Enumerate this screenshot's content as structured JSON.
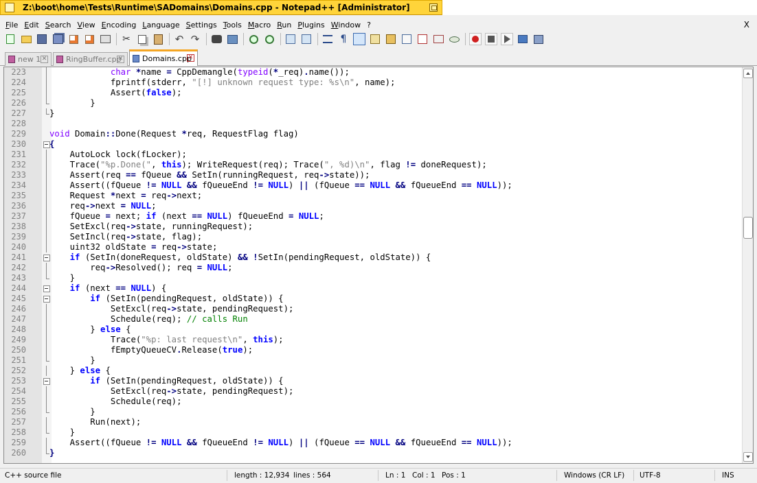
{
  "window": {
    "title": "Z:\\boot\\home\\Tests\\Runtime\\SADomains\\Domains.cpp - Notepad++ [Administrator]"
  },
  "menu": {
    "items": [
      "File",
      "Edit",
      "Search",
      "View",
      "Encoding",
      "Language",
      "Settings",
      "Tools",
      "Macro",
      "Run",
      "Plugins",
      "Window",
      "?"
    ],
    "close_glyph": "X"
  },
  "toolbar": {
    "icons": [
      "new-file-icon",
      "open-file-icon",
      "save-icon",
      "save-all-icon",
      "close-file-icon",
      "close-all-icon",
      "print-icon",
      "cut-icon",
      "copy-icon",
      "paste-icon",
      "undo-icon",
      "redo-icon",
      "find-icon",
      "replace-icon",
      "zoom-in-icon",
      "zoom-out-icon",
      "sync-vertical-icon",
      "sync-horizontal-icon",
      "word-wrap-icon",
      "show-all-characters-icon",
      "indent-guide-icon",
      "user-language-icon",
      "document-map-icon",
      "document-list-icon",
      "function-list-icon",
      "folder-as-workspace-icon",
      "monitoring-icon",
      "record-macro-icon",
      "stop-recording-icon",
      "playback-icon",
      "run-macro-multiple-icon",
      "save-macro-icon"
    ]
  },
  "tabs": [
    {
      "label": "new 1",
      "active": false,
      "modified": true
    },
    {
      "label": "RingBuffer.cpp",
      "active": false,
      "modified": true
    },
    {
      "label": "Domains.cpp",
      "active": true,
      "modified": false
    }
  ],
  "editor": {
    "lines": [
      {
        "n": "223",
        "fold": "bar",
        "code": [
          [
            "",
            "            "
          ],
          [
            "ty",
            "char"
          ],
          [
            "op",
            " *"
          ],
          [
            "",
            "name "
          ],
          [
            "op",
            "="
          ],
          [
            "",
            " CppDemangle("
          ],
          [
            "ty",
            "typeid"
          ],
          [
            "",
            "("
          ],
          [
            "op",
            "*"
          ],
          [
            "",
            "_req)"
          ],
          [
            "op",
            "."
          ],
          [
            "",
            "name());"
          ]
        ]
      },
      {
        "n": "224",
        "fold": "bar",
        "code": [
          [
            "",
            "            fprintf(stderr, "
          ],
          [
            "st",
            "\"[!] unknown request type: %s\\n\""
          ],
          [
            "",
            ", name);"
          ]
        ]
      },
      {
        "n": "225",
        "fold": "bar",
        "code": [
          [
            "",
            "            Assert("
          ],
          [
            "kw",
            "false"
          ],
          [
            "",
            ");"
          ]
        ]
      },
      {
        "n": "226",
        "fold": "end",
        "code": [
          [
            "",
            "        }"
          ]
        ]
      },
      {
        "n": "227",
        "fold": "end",
        "code": [
          [
            "",
            "}"
          ]
        ]
      },
      {
        "n": "228",
        "fold": "",
        "code": [
          [
            "",
            ""
          ]
        ]
      },
      {
        "n": "229",
        "fold": "",
        "code": [
          [
            "ty",
            "void"
          ],
          [
            "",
            " Domain"
          ],
          [
            "op",
            "::"
          ],
          [
            "",
            "Done(Request "
          ],
          [
            "op",
            "*"
          ],
          [
            "",
            "req, RequestFlag flag)"
          ]
        ]
      },
      {
        "n": "230",
        "fold": "box",
        "code": [
          [
            "op",
            "{"
          ]
        ]
      },
      {
        "n": "231",
        "fold": "bar",
        "code": [
          [
            "",
            "    AutoLock lock(fLocker);"
          ]
        ]
      },
      {
        "n": "232",
        "fold": "bar",
        "code": [
          [
            "",
            "    Trace("
          ],
          [
            "st",
            "\"%p.Done(\""
          ],
          [
            "",
            ", "
          ],
          [
            "kw",
            "this"
          ],
          [
            "",
            "); WriteRequest(req); Trace("
          ],
          [
            "st",
            "\", %d)\\n\""
          ],
          [
            "",
            ", flag "
          ],
          [
            "op",
            "!="
          ],
          [
            "",
            " doneRequest);"
          ]
        ]
      },
      {
        "n": "233",
        "fold": "bar",
        "code": [
          [
            "",
            "    Assert(req "
          ],
          [
            "op",
            "=="
          ],
          [
            "",
            " fQueue "
          ],
          [
            "op",
            "&&"
          ],
          [
            "",
            " SetIn(runningRequest, req"
          ],
          [
            "op",
            "->"
          ],
          [
            "",
            "state));"
          ]
        ]
      },
      {
        "n": "234",
        "fold": "bar",
        "code": [
          [
            "",
            "    Assert((fQueue "
          ],
          [
            "op",
            "!="
          ],
          [
            "",
            " "
          ],
          [
            "kw",
            "NULL"
          ],
          [
            "",
            " "
          ],
          [
            "op",
            "&&"
          ],
          [
            "",
            " fQueueEnd "
          ],
          [
            "op",
            "!="
          ],
          [
            "",
            " "
          ],
          [
            "kw",
            "NULL"
          ],
          [
            "",
            ") "
          ],
          [
            "op",
            "||"
          ],
          [
            "",
            " (fQueue "
          ],
          [
            "op",
            "=="
          ],
          [
            "",
            " "
          ],
          [
            "kw",
            "NULL"
          ],
          [
            "",
            " "
          ],
          [
            "op",
            "&&"
          ],
          [
            "",
            " fQueueEnd "
          ],
          [
            "op",
            "=="
          ],
          [
            "",
            " "
          ],
          [
            "kw",
            "NULL"
          ],
          [
            "",
            "));"
          ]
        ]
      },
      {
        "n": "235",
        "fold": "bar",
        "code": [
          [
            "",
            "    Request "
          ],
          [
            "op",
            "*"
          ],
          [
            "",
            "next "
          ],
          [
            "op",
            "="
          ],
          [
            "",
            " req"
          ],
          [
            "op",
            "->"
          ],
          [
            "",
            "next;"
          ]
        ]
      },
      {
        "n": "236",
        "fold": "bar",
        "code": [
          [
            "",
            "    req"
          ],
          [
            "op",
            "->"
          ],
          [
            "",
            "next "
          ],
          [
            "op",
            "="
          ],
          [
            "",
            " "
          ],
          [
            "kw",
            "NULL"
          ],
          [
            "",
            ";"
          ]
        ]
      },
      {
        "n": "237",
        "fold": "bar",
        "code": [
          [
            "",
            "    fQueue "
          ],
          [
            "op",
            "="
          ],
          [
            "",
            " next; "
          ],
          [
            "kw",
            "if"
          ],
          [
            "",
            " (next "
          ],
          [
            "op",
            "=="
          ],
          [
            "",
            " "
          ],
          [
            "kw",
            "NULL"
          ],
          [
            "",
            ") fQueueEnd "
          ],
          [
            "op",
            "="
          ],
          [
            "",
            " "
          ],
          [
            "kw",
            "NULL"
          ],
          [
            "",
            ";"
          ]
        ]
      },
      {
        "n": "238",
        "fold": "bar",
        "code": [
          [
            "",
            "    SetExcl(req"
          ],
          [
            "op",
            "->"
          ],
          [
            "",
            "state, runningRequest);"
          ]
        ]
      },
      {
        "n": "239",
        "fold": "bar",
        "code": [
          [
            "",
            "    SetIncl(req"
          ],
          [
            "op",
            "->"
          ],
          [
            "",
            "state, flag);"
          ]
        ]
      },
      {
        "n": "240",
        "fold": "bar",
        "code": [
          [
            "",
            "    uint32 oldState "
          ],
          [
            "op",
            "="
          ],
          [
            "",
            " req"
          ],
          [
            "op",
            "->"
          ],
          [
            "",
            "state;"
          ]
        ]
      },
      {
        "n": "241",
        "fold": "box",
        "code": [
          [
            "",
            "    "
          ],
          [
            "kw",
            "if"
          ],
          [
            "",
            " (SetIn(doneRequest, oldState) "
          ],
          [
            "op",
            "&&"
          ],
          [
            "",
            " "
          ],
          [
            "op",
            "!"
          ],
          [
            "",
            "SetIn(pendingRequest, oldState)) {"
          ]
        ]
      },
      {
        "n": "242",
        "fold": "bar",
        "code": [
          [
            "",
            "        req"
          ],
          [
            "op",
            "->"
          ],
          [
            "",
            "Resolved(); req "
          ],
          [
            "op",
            "="
          ],
          [
            "",
            " "
          ],
          [
            "kw",
            "NULL"
          ],
          [
            "",
            ";"
          ]
        ]
      },
      {
        "n": "243",
        "fold": "end",
        "code": [
          [
            "",
            "    }"
          ]
        ]
      },
      {
        "n": "244",
        "fold": "box",
        "code": [
          [
            "",
            "    "
          ],
          [
            "kw",
            "if"
          ],
          [
            "",
            " (next "
          ],
          [
            "op",
            "=="
          ],
          [
            "",
            " "
          ],
          [
            "kw",
            "NULL"
          ],
          [
            "",
            ") {"
          ]
        ]
      },
      {
        "n": "245",
        "fold": "box",
        "code": [
          [
            "",
            "        "
          ],
          [
            "kw",
            "if"
          ],
          [
            "",
            " (SetIn(pendingRequest, oldState)) {"
          ]
        ]
      },
      {
        "n": "246",
        "fold": "bar",
        "code": [
          [
            "",
            "            SetExcl(req"
          ],
          [
            "op",
            "->"
          ],
          [
            "",
            "state, pendingRequest);"
          ]
        ]
      },
      {
        "n": "247",
        "fold": "bar",
        "code": [
          [
            "",
            "            Schedule(req); "
          ],
          [
            "cm",
            "// calls Run"
          ]
        ]
      },
      {
        "n": "248",
        "fold": "bar",
        "code": [
          [
            "",
            "        } "
          ],
          [
            "kw",
            "else"
          ],
          [
            "",
            " {"
          ]
        ]
      },
      {
        "n": "249",
        "fold": "bar",
        "code": [
          [
            "",
            "            Trace("
          ],
          [
            "st",
            "\"%p: last request\\n\""
          ],
          [
            "",
            ", "
          ],
          [
            "kw",
            "this"
          ],
          [
            "",
            ");"
          ]
        ]
      },
      {
        "n": "250",
        "fold": "bar",
        "code": [
          [
            "",
            "            fEmptyQueueCV"
          ],
          [
            "op",
            "."
          ],
          [
            "",
            "Release("
          ],
          [
            "kw",
            "true"
          ],
          [
            "",
            ");"
          ]
        ]
      },
      {
        "n": "251",
        "fold": "end",
        "code": [
          [
            "",
            "        }"
          ]
        ]
      },
      {
        "n": "252",
        "fold": "bar",
        "code": [
          [
            "",
            "    } "
          ],
          [
            "kw",
            "else"
          ],
          [
            "",
            " {"
          ]
        ]
      },
      {
        "n": "253",
        "fold": "box",
        "code": [
          [
            "",
            "        "
          ],
          [
            "kw",
            "if"
          ],
          [
            "",
            " (SetIn(pendingRequest, oldState)) {"
          ]
        ]
      },
      {
        "n": "254",
        "fold": "bar",
        "code": [
          [
            "",
            "            SetExcl(req"
          ],
          [
            "op",
            "->"
          ],
          [
            "",
            "state, pendingRequest);"
          ]
        ]
      },
      {
        "n": "255",
        "fold": "bar",
        "code": [
          [
            "",
            "            Schedule(req);"
          ]
        ]
      },
      {
        "n": "256",
        "fold": "end",
        "code": [
          [
            "",
            "        }"
          ]
        ]
      },
      {
        "n": "257",
        "fold": "bar",
        "code": [
          [
            "",
            "        Run(next);"
          ]
        ]
      },
      {
        "n": "258",
        "fold": "end",
        "code": [
          [
            "",
            "    }"
          ]
        ]
      },
      {
        "n": "259",
        "fold": "bar",
        "code": [
          [
            "",
            "    Assert((fQueue "
          ],
          [
            "op",
            "!="
          ],
          [
            "",
            " "
          ],
          [
            "kw",
            "NULL"
          ],
          [
            "",
            " "
          ],
          [
            "op",
            "&&"
          ],
          [
            "",
            " fQueueEnd "
          ],
          [
            "op",
            "!="
          ],
          [
            "",
            " "
          ],
          [
            "kw",
            "NULL"
          ],
          [
            "",
            ") "
          ],
          [
            "op",
            "||"
          ],
          [
            "",
            " (fQueue "
          ],
          [
            "op",
            "=="
          ],
          [
            "",
            " "
          ],
          [
            "kw",
            "NULL"
          ],
          [
            "",
            " "
          ],
          [
            "op",
            "&&"
          ],
          [
            "",
            " fQueueEnd "
          ],
          [
            "op",
            "=="
          ],
          [
            "",
            " "
          ],
          [
            "kw",
            "NULL"
          ],
          [
            "",
            "));"
          ]
        ]
      },
      {
        "n": "260",
        "fold": "end",
        "code": [
          [
            "op",
            "}"
          ]
        ]
      }
    ]
  },
  "statusbar": {
    "file_type": "C++ source file",
    "length": "length : 12,934",
    "lines": "lines : 564",
    "ln": "Ln : 1",
    "col": "Col : 1",
    "pos": "Pos : 1",
    "eol": "Windows (CR LF)",
    "encoding": "UTF-8",
    "mode": "INS"
  }
}
